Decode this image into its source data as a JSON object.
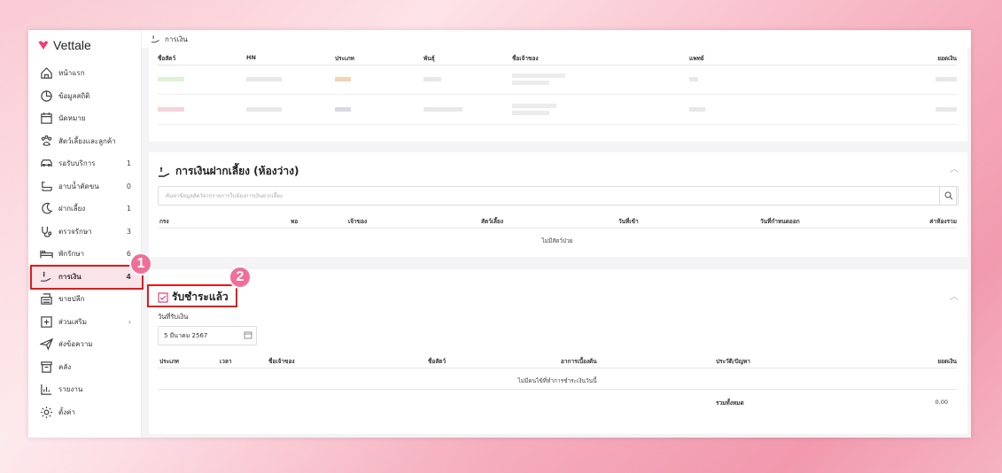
{
  "app": {
    "name": "Vettale"
  },
  "sidebar": {
    "items": [
      {
        "label": "หน้าแรก",
        "icon": "home-icon",
        "count": ""
      },
      {
        "label": "ข้อมูลสถิติ",
        "icon": "chart-icon",
        "count": ""
      },
      {
        "label": "นัดหมาย",
        "icon": "calendar-icon",
        "count": ""
      },
      {
        "label": "สัตว์เลี้ยงและลูกค้า",
        "icon": "paw-icon",
        "count": ""
      },
      {
        "label": "รอรับบริการ",
        "icon": "car-icon",
        "count": "1"
      },
      {
        "label": "อาบน้ำตัดขน",
        "icon": "bath-icon",
        "count": "0"
      },
      {
        "label": "ฝากเลี้ยง",
        "icon": "moon-icon",
        "count": "1"
      },
      {
        "label": "ตรวจรักษา",
        "icon": "stethoscope-icon",
        "count": "3"
      },
      {
        "label": "พักรักษา",
        "icon": "bed-icon",
        "count": "6"
      },
      {
        "label": "การเงิน",
        "icon": "money-hand-icon",
        "count": "4",
        "active": true
      },
      {
        "label": "ขายปลีก",
        "icon": "register-icon",
        "count": ""
      },
      {
        "label": "ส่วนเสริม",
        "icon": "plus-square-icon",
        "count": "",
        "chevron": "›"
      },
      {
        "label": "ส่งข้อความ",
        "icon": "send-icon",
        "count": ""
      },
      {
        "label": "คลัง",
        "icon": "archive-icon",
        "count": ""
      },
      {
        "label": "รายงาน",
        "icon": "report-icon",
        "count": ""
      },
      {
        "label": "ตั้งค่า",
        "icon": "gear-icon",
        "count": ""
      }
    ]
  },
  "badges": {
    "one": "1",
    "two": "2"
  },
  "topbar": {
    "breadcrumb": "การเงิน"
  },
  "pending_table": {
    "headers": [
      "ชื่อสัตว์",
      "HN",
      "ประเภท",
      "พันธุ์",
      "ชื่อเจ้าของ",
      "แพทย์",
      "ยอดเงิน"
    ]
  },
  "boarding": {
    "title": "การเงินฝากเลี้ยง (ห้องว่าง)",
    "search_placeholder": "ค้นหาข้อมูลสัตว์จากรายการใบห้องการเงินฝากเลี้ยง",
    "headers": [
      "กรง",
      "หอ",
      "เจ้าของ",
      "สัตว์เลี้ยง",
      "วันที่เข้า",
      "วันที่กำหนดออก",
      "ค่าห้องรวม"
    ],
    "empty": "ไม่มีสัตว์ป่วย"
  },
  "paid": {
    "title": "รับชำระแล้ว",
    "date_label": "วันที่รับเงิน",
    "date_value": "5 มีนาคม 2567",
    "headers": [
      "ประเภท",
      "เวลา",
      "ชื่อเจ้าของ",
      "ชื่อสัตว์",
      "อาการเบื้องต้น",
      "ประวัติ/ปัญหา",
      "ยอดเงิน"
    ],
    "empty": "ไม่มีคนไข้ที่ทำการชำระเงินวันนี้",
    "total_label": "รวมทั้งหมด",
    "total_value": "0.00"
  },
  "colors": {
    "accent": "#ef6f98",
    "highlight": "#e31919"
  }
}
